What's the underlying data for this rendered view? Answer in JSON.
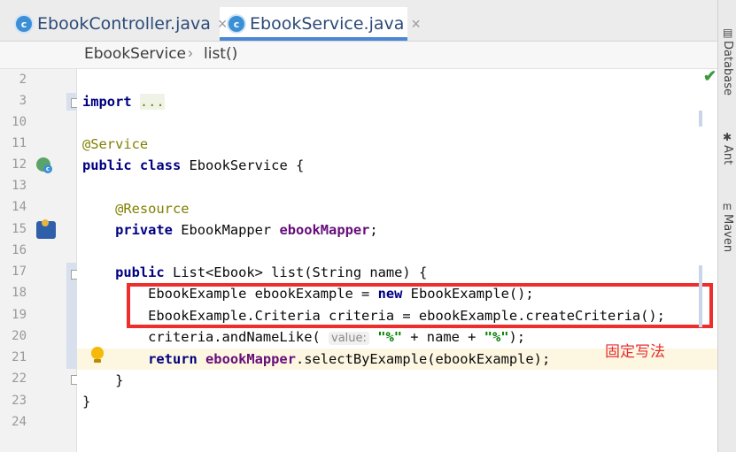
{
  "tabs": [
    {
      "icon": "class-icon",
      "icon_glyph": "c",
      "label": "EbookController.java",
      "close": "×"
    },
    {
      "icon": "class-icon",
      "icon_glyph": "c",
      "label": "EbookService.java",
      "close": "×",
      "active": true
    }
  ],
  "breadcrumb": {
    "class": "EbookService",
    "separator": "›",
    "method": "list()"
  },
  "right_tools": [
    {
      "label": "Database",
      "icon": "database-icon"
    },
    {
      "label": "Ant",
      "icon": "ant-icon"
    },
    {
      "label": "Maven",
      "icon": "maven-icon"
    }
  ],
  "line_numbers": [
    "2",
    "3",
    "10",
    "11",
    "12",
    "13",
    "14",
    "15",
    "16",
    "17",
    "18",
    "19",
    "20",
    "21",
    "22",
    "23",
    "24"
  ],
  "code": {
    "l3_kw": "import",
    "l3_dots": "...",
    "l11_ann": "@Service",
    "l12_kw1": "public",
    "l12_kw2": "class",
    "l12_rest": "EbookService {",
    "l14_ann": "@Resource",
    "l15_kw": "private",
    "l15_type": "EbookMapper",
    "l15_field": "ebookMapper",
    "l15_end": ";",
    "l17_kw": "public",
    "l17_rest": "List<Ebook> list(String name) {",
    "l18_a": "EbookExample ebookExample = ",
    "l18_kw": "new",
    "l18_b": " EbookExample();",
    "l19": "EbookExample.Criteria criteria = ebookExample.createCriteria();",
    "l20_a": "criteria.andNameLike(",
    "l20_hint": "value:",
    "l20_str1": "\"%\"",
    "l20_b": " + name + ",
    "l20_str2": "\"%\"",
    "l20_c": ");",
    "l21_kw": "return",
    "l21_field": "ebookMapper",
    "l21_rest": ".selectByExample(ebookExample);",
    "l22": "}",
    "l23": "}"
  },
  "annotation_note": "固定写法",
  "colors": {
    "annotation_box": "#ee2d2d",
    "keyword": "#000080",
    "annotation": "#808000",
    "field": "#660e7a",
    "string": "#008000"
  }
}
